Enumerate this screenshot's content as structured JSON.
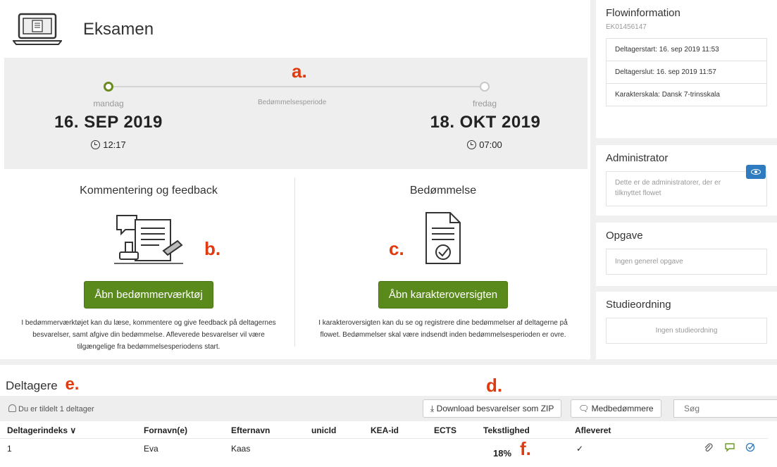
{
  "header": {
    "title": "Eksamen"
  },
  "period": {
    "middle_label": "Bedømmelsesperiode",
    "start": {
      "day": "mandag",
      "date": "16. SEP 2019",
      "time": "12:17"
    },
    "end": {
      "day": "fredag",
      "date": "18. OKT 2019",
      "time": "07:00"
    }
  },
  "annotations": {
    "a": "a.",
    "b": "b.",
    "c": "c.",
    "d": "d.",
    "e": "e.",
    "f": "f."
  },
  "cards": {
    "feedback": {
      "title": "Kommentering og feedback",
      "button": "Åbn bedømmerværktøj",
      "text": "I bedømmerværktøjet kan du læse, kommentere og give feedback på deltagernes besvarelser, samt afgive din bedømmelse. Afleverede besvarelser vil være tilgængelige fra bedømmelsesperiodens start."
    },
    "grading": {
      "title": "Bedømmelse",
      "button": "Åbn karakteroversigten",
      "text": "I karakteroversigten kan du se og registrere dine bedømmelser af deltagerne på flowet. Bedømmelser skal være indsendt inden bedømmelsesperioden er ovre."
    }
  },
  "sidebar": {
    "flow_title": "Flowinformation",
    "flow_id": "EK01456147",
    "flow_rows": [
      "Deltagerstart: 16. sep 2019 11:53",
      "Deltagerslut: 16. sep 2019 11:57",
      "Karakterskala: Dansk 7-trinsskala"
    ],
    "admin_title": "Administrator",
    "admin_text": "Dette er de administratorer, der er tilknyttet flowet",
    "task_title": "Opgave",
    "task_text": "Ingen generel opgave",
    "study_title": "Studieordning",
    "study_text": "Ingen studieordning"
  },
  "participants": {
    "title": "Deltagere",
    "assigned": "Du er tildelt 1 deltager",
    "download_button": "Download besvarelser som ZIP",
    "co_graders_button": "Medbedømmere",
    "search_placeholder": "Søg",
    "columns": [
      "Deltagerindeks",
      "Fornavn(e)",
      "Efternavn",
      "unicId",
      "KEA-id",
      "ECTS",
      "Tekstlighed",
      "Afleveret"
    ],
    "sort_indicator": "∨",
    "rows": [
      {
        "index": "1",
        "first": "Eva",
        "last": "Kaas",
        "unicid": "",
        "kea": "",
        "ects": "",
        "similarity": "18%",
        "submitted": "✓"
      }
    ]
  },
  "colors": {
    "accent_green": "#5b8a1c",
    "annotation_red": "#e03a10",
    "info_blue": "#2e7bbf"
  },
  "icons": [
    "laptop-icon",
    "clock-icon",
    "feedback-tools-icon",
    "grade-document-icon",
    "eye-icon",
    "person-icon",
    "download-icon",
    "comment-icon",
    "paperclip-icon",
    "checkbox-icon"
  ]
}
